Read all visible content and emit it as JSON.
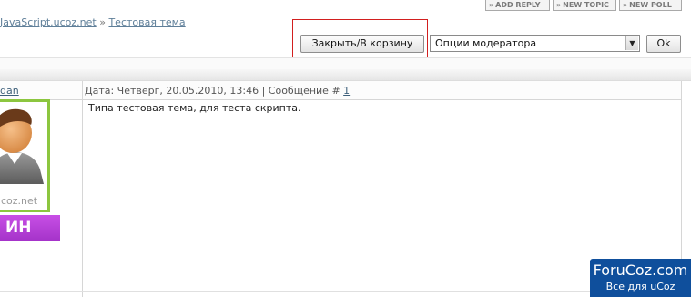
{
  "top_buttons": [
    {
      "icon": "double-chevron-right-icon",
      "label": "ADD REPLY"
    },
    {
      "icon": "double-chevron-right-icon",
      "label": "NEW TOPIC"
    },
    {
      "icon": "double-chevron-right-icon",
      "label": "NEW POLL"
    }
  ],
  "breadcrumb": {
    "site": "JavaScript.ucoz.net",
    "separator": "»",
    "topic": "Тестовая тема"
  },
  "moderation": {
    "close_button": "Закрыть/В корзину",
    "options_value": "Опции модератора",
    "ok_button": "Ok"
  },
  "post": {
    "author_nick": "dan",
    "meta_prefix": "Дата: Четверг, 20.05.2010, 13:46 | Сообщение #",
    "post_number": "1",
    "text": "Типа тестовая тема, для теста скрипта.",
    "avatar_watermark": "ucoz.net",
    "rank_label": "ИН"
  },
  "badge": {
    "title": "ForuCoz.com",
    "subtitle": "Все для uCoz"
  },
  "colors": {
    "highlight_box": "#d21f1f",
    "avatar_border": "#8cc63f",
    "rank_background": "#b03fd6",
    "badge_background": "#0f4f9c",
    "link": "#3d5f7a"
  }
}
